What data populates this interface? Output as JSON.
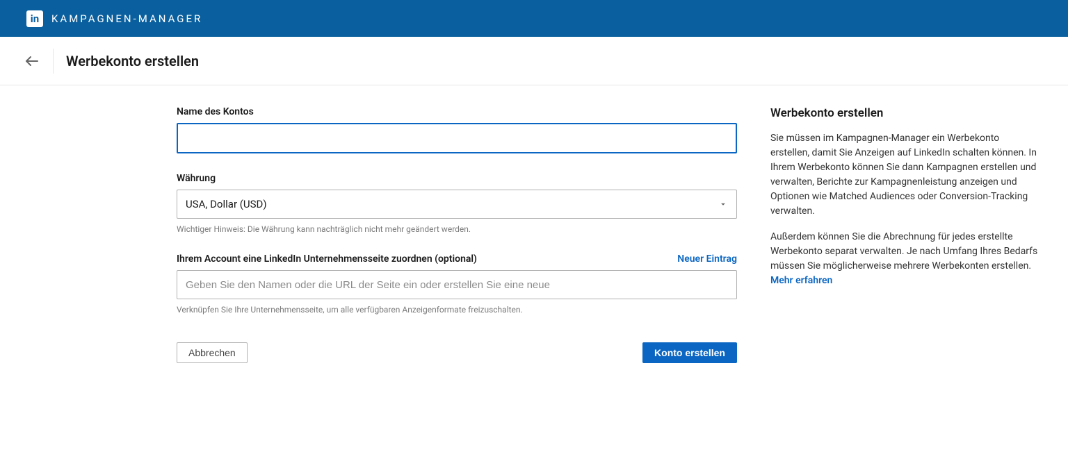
{
  "header": {
    "logo_text": "in",
    "app_name": "KAMPAGNEN-MANAGER"
  },
  "subheader": {
    "page_title": "Werbekonto erstellen"
  },
  "form": {
    "account_name": {
      "label": "Name des Kontos",
      "value": ""
    },
    "currency": {
      "label": "Währung",
      "selected": "USA, Dollar (USD)",
      "hint": "Wichtiger Hinweis: Die Währung kann nachträglich nicht mehr geändert werden."
    },
    "company_page": {
      "label": "Ihrem Account eine LinkedIn Unternehmensseite zuordnen (optional)",
      "new_entry_link": "Neuer Eintrag",
      "placeholder": "Geben Sie den Namen oder die URL der Seite ein oder erstellen Sie eine neue",
      "hint": "Verknüpfen Sie Ihre Unternehmensseite, um alle verfügbaren Anzeigenformate freizuschalten."
    },
    "buttons": {
      "cancel": "Abbrechen",
      "create": "Konto erstellen"
    }
  },
  "sidebar": {
    "title": "Werbekonto erstellen",
    "para1": "Sie müssen im Kampagnen-Manager ein Werbekonto erstellen, damit Sie Anzeigen auf LinkedIn schalten können. In Ihrem Werbekonto können Sie dann Kampagnen erstellen und verwalten, Berichte zur Kampagnenleistung anzeigen und Optionen wie Matched Audiences oder Conversion-Tracking verwalten.",
    "para2_prefix": "Außerdem können Sie die Abrechnung für jedes erstellte Werbekonto separat verwalten. Je nach Umfang Ihres Bedarfs müssen Sie möglicherweise mehrere Werbekonten erstellen. ",
    "para2_link": "Mehr erfahren"
  }
}
